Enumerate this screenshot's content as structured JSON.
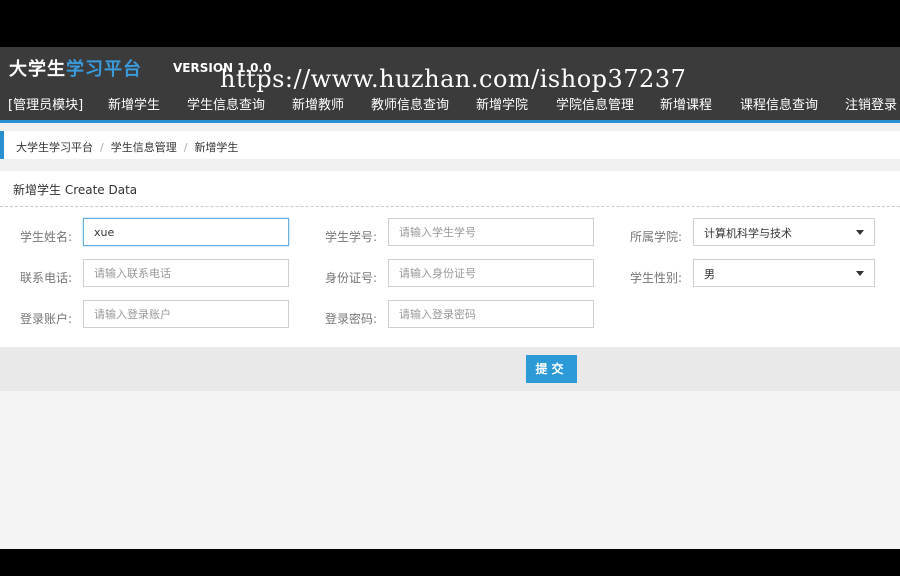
{
  "header": {
    "logo_part1": "大学生",
    "logo_part2": "学习平台",
    "version": "VERSION 1.0.0",
    "watermark": "https://www.huzhan.com/ishop37237"
  },
  "nav": {
    "items": [
      {
        "label": "[管理员模块]"
      },
      {
        "label": "新增学生"
      },
      {
        "label": "学生信息查询"
      },
      {
        "label": "新增教师"
      },
      {
        "label": "教师信息查询"
      },
      {
        "label": "新增学院"
      },
      {
        "label": "学院信息管理"
      },
      {
        "label": "新增课程"
      },
      {
        "label": "课程信息查询"
      },
      {
        "label": "注销登录"
      }
    ]
  },
  "breadcrumb": {
    "items": [
      "大学生学习平台",
      "学生信息管理",
      "新增学生"
    ],
    "separator": "/"
  },
  "form": {
    "title": "新增学生 Create Data",
    "name": {
      "label": "学生姓名:",
      "value": "xue",
      "placeholder": ""
    },
    "student_id": {
      "label": "学生学号:",
      "value": "",
      "placeholder": "请输入学生学号"
    },
    "college": {
      "label": "所属学院:",
      "selected": "计算机科学与技术"
    },
    "phone": {
      "label": "联系电话:",
      "value": "",
      "placeholder": "请输入联系电话"
    },
    "id_card": {
      "label": "身份证号:",
      "value": "",
      "placeholder": "请输入身份证号"
    },
    "gender": {
      "label": "学生性别:",
      "selected": "男"
    },
    "account": {
      "label": "登录账户:",
      "value": "",
      "placeholder": "请输入登录账户"
    },
    "password": {
      "label": "登录密码:",
      "value": "",
      "placeholder": "请输入登录密码"
    },
    "submit_label": "提交"
  },
  "colors": {
    "topbar": "#3b3b3b",
    "accent": "#2a8fd0",
    "submit": "#2d9ad8"
  }
}
